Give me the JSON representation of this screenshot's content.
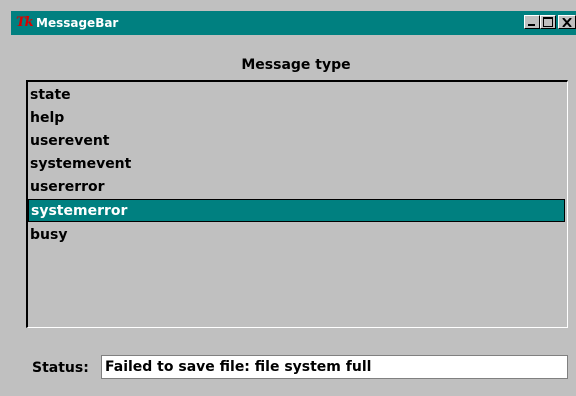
{
  "window": {
    "title": "MessageBar",
    "logo_text": "Tk",
    "controls": [
      "minimize",
      "maximize",
      "close"
    ]
  },
  "message_type": {
    "heading": "Message type",
    "items": [
      {
        "label": "state",
        "selected": false
      },
      {
        "label": "help",
        "selected": false
      },
      {
        "label": "userevent",
        "selected": false
      },
      {
        "label": "systemevent",
        "selected": false
      },
      {
        "label": "usererror",
        "selected": false
      },
      {
        "label": "systemerror",
        "selected": true
      },
      {
        "label": "busy",
        "selected": false
      }
    ]
  },
  "status": {
    "label": "Status:",
    "message": "Failed to save file: file system full"
  },
  "colors": {
    "titlebar": "#008080",
    "selection": "#008080",
    "background": "#c0c0c0"
  }
}
